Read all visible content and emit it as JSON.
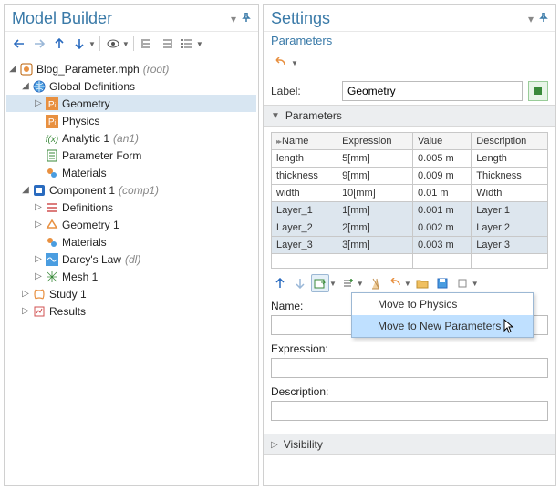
{
  "left": {
    "title": "Model Builder",
    "tree": {
      "root": "Blog_Parameter.mph",
      "root_anno": "(root)",
      "global_defs": "Global Definitions",
      "geometry": "Geometry",
      "physics": "Physics",
      "analytic": "Analytic 1",
      "analytic_anno": "(an1)",
      "param_form": "Parameter Form",
      "materials": "Materials",
      "component": "Component 1",
      "component_anno": "(comp1)",
      "definitions": "Definitions",
      "geometry1": "Geometry 1",
      "materials1": "Materials",
      "darcy": "Darcy's Law",
      "darcy_anno": "(dl)",
      "mesh": "Mesh 1",
      "study": "Study 1",
      "results": "Results"
    }
  },
  "right": {
    "title": "Settings",
    "subtitle": "Parameters",
    "label_label": "Label:",
    "label_value": "Geometry",
    "section_params": "Parameters",
    "section_visibility": "Visibility",
    "table": {
      "headers": {
        "name": "Name",
        "expression": "Expression",
        "value": "Value",
        "description": "Description"
      },
      "rows": [
        {
          "name": "length",
          "expr": "5[mm]",
          "value": "0.005 m",
          "desc": "Length",
          "sel": false
        },
        {
          "name": "thickness",
          "expr": "9[mm]",
          "value": "0.009 m",
          "desc": "Thickness",
          "sel": false
        },
        {
          "name": "width",
          "expr": "10[mm]",
          "value": "0.01 m",
          "desc": "Width",
          "sel": false
        },
        {
          "name": "Layer_1",
          "expr": "1[mm]",
          "value": "0.001 m",
          "desc": "Layer 1",
          "sel": true
        },
        {
          "name": "Layer_2",
          "expr": "2[mm]",
          "value": "0.002 m",
          "desc": "Layer 2",
          "sel": true
        },
        {
          "name": "Layer_3",
          "expr": "3[mm]",
          "value": "0.003 m",
          "desc": "Layer 3",
          "sel": true
        }
      ]
    },
    "fields": {
      "name": "Name:",
      "expression": "Expression:",
      "description": "Description:"
    },
    "menu": {
      "to_physics": "Move to Physics",
      "to_new": "Move to New Parameters"
    }
  }
}
